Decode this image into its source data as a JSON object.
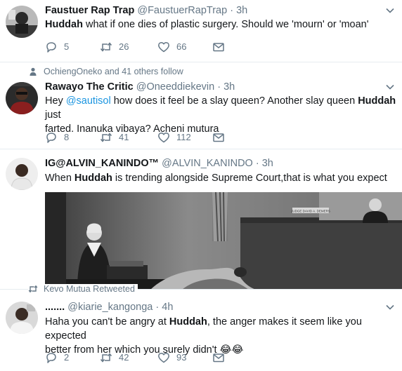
{
  "tweets": [
    {
      "name": "Faustuer Rap Trap",
      "handle": "@FaustuerRapTrap",
      "time": "3h",
      "text_pre": "",
      "text_highlight": "Huddah",
      "text_post": " what if one dies of plastic surgery. Should we 'mourn' or 'moan'",
      "replies": "5",
      "retweets": "26",
      "likes": "66"
    },
    {
      "context": "OchiengOneko and 41 others follow",
      "name": "Rawayo The Critic",
      "handle": "@Oneeddiekevin",
      "time": "3h",
      "text_a": "Hey ",
      "text_mention": "@sautisol",
      "text_b": " how does it feel be a slay queen? Another slay queen ",
      "text_highlight": "Huddah",
      "text_c": " just",
      "text_line2": "farted. Inanuka vibaya? Acheni mutura",
      "replies": "8",
      "retweets": "41",
      "likes": "112"
    },
    {
      "name": "IG@ALVIN_KANINDO™",
      "handle": "@ALVIN_KANINDO",
      "time": "3h",
      "text_pre": "When ",
      "text_highlight": "Huddah",
      "text_post": " is trending alongside Supreme Court,that is what you expect",
      "media_sign": "JUDGE DAVID A. DEMERS"
    },
    {
      "context": "Kevo Mutua Retweeted",
      "name": ".......",
      "handle": "@kiarie_kangonga",
      "time": "4h",
      "text_pre": "Haha you can't be angry at ",
      "text_highlight": "Huddah",
      "text_post": ", the anger makes it seem like you expected",
      "text_line2": "better from her which you surely didn't ",
      "emoji": "😂😂",
      "replies": "2",
      "retweets": "42",
      "likes": "93"
    }
  ],
  "colors": {
    "text": "#14171a",
    "secondary": "#657786",
    "link": "#1b95e0",
    "divider": "#e6ecf0"
  },
  "icons": [
    "reply-icon",
    "retweet-icon",
    "like-icon",
    "direct-message-icon",
    "chevron-down-icon",
    "person-icon"
  ]
}
